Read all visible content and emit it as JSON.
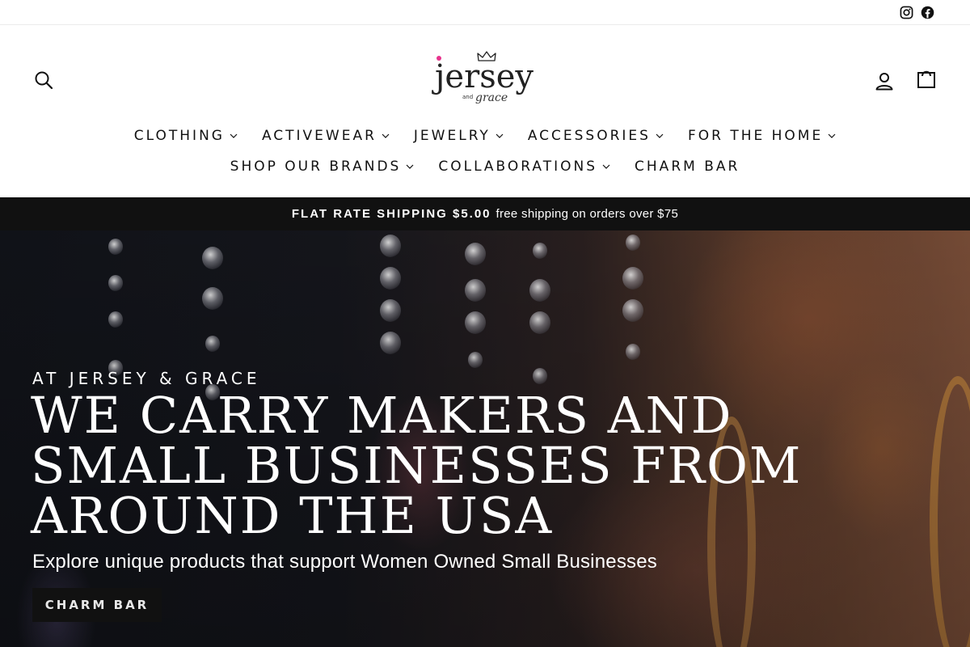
{
  "utility": {
    "social": [
      {
        "name": "instagram-icon"
      },
      {
        "name": "facebook-icon"
      }
    ]
  },
  "header": {
    "logo": {
      "word": "jersey",
      "and": "and",
      "grace": "grace"
    },
    "icons": [
      "search-icon",
      "user-icon",
      "shopping-bag-icon"
    ]
  },
  "nav": {
    "row1": [
      {
        "label": "CLOTHING",
        "dropdown": true
      },
      {
        "label": "ACTIVEWEAR",
        "dropdown": true
      },
      {
        "label": "JEWELRY",
        "dropdown": true
      },
      {
        "label": "ACCESSORIES",
        "dropdown": true
      },
      {
        "label": "FOR THE HOME",
        "dropdown": true
      }
    ],
    "row2": [
      {
        "label": "SHOP OUR BRANDS",
        "dropdown": true
      },
      {
        "label": "COLLABORATIONS",
        "dropdown": true
      },
      {
        "label": "CHARM BAR",
        "dropdown": false
      }
    ]
  },
  "announcement": {
    "strong": "FLAT RATE SHIPPING $5.00",
    "text": "free shipping on orders over $75"
  },
  "hero": {
    "kicker": "AT JERSEY & GRACE",
    "headline": "WE CARRY MAKERS AND SMALL BUSINESSES FROM AROUND THE USA",
    "subheading": "Explore unique products that support Women Owned Small Businesses",
    "cta_label": "CHARM BAR"
  },
  "colors": {
    "announcement_bg": "#111111",
    "text": "#111111",
    "logo_dot": "#e8338d",
    "cta_bg": "#111111"
  }
}
